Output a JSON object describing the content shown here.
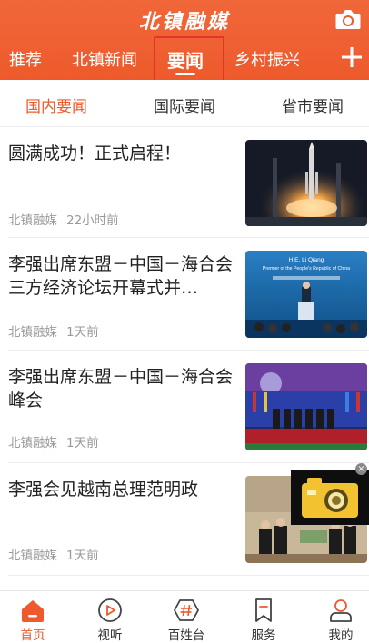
{
  "header": {
    "logo_text": "北镇融媒",
    "icons": {
      "camera": "camera-icon",
      "add": "plus-icon"
    },
    "accent_color": "#ee5a2c",
    "tabs": [
      {
        "label": "推荐"
      },
      {
        "label": "北镇新闻"
      },
      {
        "label": "要闻",
        "active": true
      },
      {
        "label": "乡村振兴"
      }
    ]
  },
  "subtabs": [
    {
      "label": "国内要闻",
      "active": true
    },
    {
      "label": "国际要闻"
    },
    {
      "label": "省市要闻"
    }
  ],
  "news": [
    {
      "title": "圆满成功！正式启程！",
      "source": "北镇融媒",
      "time": "22小时前",
      "image": "rocket-launch-photo"
    },
    {
      "title": "李强出席东盟－中国－海合会三方经济论坛开幕式并…",
      "source": "北镇融媒",
      "time": "1天前",
      "image": "forum-speech-photo",
      "image_text": {
        "line1": "H.E. Li Qiang",
        "line2": "Premier of the People's Republic of China"
      }
    },
    {
      "title": "李强出席东盟－中国－海合会峰会",
      "source": "北镇融媒",
      "time": "1天前",
      "image": "summit-group-photo"
    },
    {
      "title": "李强会见越南总理范明政",
      "source": "北镇融媒",
      "time": "1天前",
      "image": "meeting-photo"
    }
  ],
  "bottom_nav": [
    {
      "label": "首页",
      "icon": "home-icon",
      "active": true
    },
    {
      "label": "视听",
      "icon": "play-icon"
    },
    {
      "label": "百姓台",
      "icon": "hashtag-icon"
    },
    {
      "label": "服务",
      "icon": "bookmark-icon"
    },
    {
      "label": "我的",
      "icon": "user-icon"
    }
  ]
}
